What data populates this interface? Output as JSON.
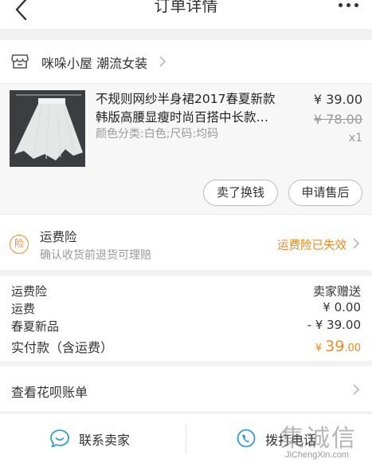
{
  "header": {
    "title": "订单详情"
  },
  "shop": {
    "name": "咪哚小屋 潮流女装"
  },
  "product": {
    "title": "不规则网纱半身裙2017春夏新款韩版高腰显瘦时尚百搭中长款…",
    "sku": "颜色分类:白色;尺码:均码",
    "price": "¥ 39.00",
    "original_price": "¥ 78.00",
    "quantity": "x1",
    "buttons": {
      "sell": "卖了换钱",
      "after_sale": "申请售后"
    }
  },
  "insurance": {
    "badge": "险",
    "title": "运费险",
    "subtitle": "确认收货前退货可理赔",
    "status": "运费险已失效"
  },
  "fees": [
    {
      "label": "运费险",
      "value": "卖家赠送"
    },
    {
      "label": "运费",
      "value": "¥ 0.00"
    },
    {
      "label": "春夏新品",
      "value": "- ¥ 39.00"
    }
  ],
  "total": {
    "label": "实付款（含运费）",
    "currency": "¥",
    "integer": "39",
    "cents": ".00"
  },
  "huabei": {
    "label": "查看花呗账单"
  },
  "footer": {
    "contact": "联系卖家",
    "call": "拨打电话"
  },
  "watermark": {
    "cn": "集诚信",
    "en": "JiChengXin.com"
  },
  "colors": {
    "accent": "#f08a24",
    "background": "#f2f2f2",
    "muted": "#999999"
  },
  "icons": [
    "back-icon",
    "more-icon",
    "shop-icon",
    "chevron-right-icon",
    "insurance-badge-icon",
    "chat-icon",
    "phone-icon"
  ]
}
